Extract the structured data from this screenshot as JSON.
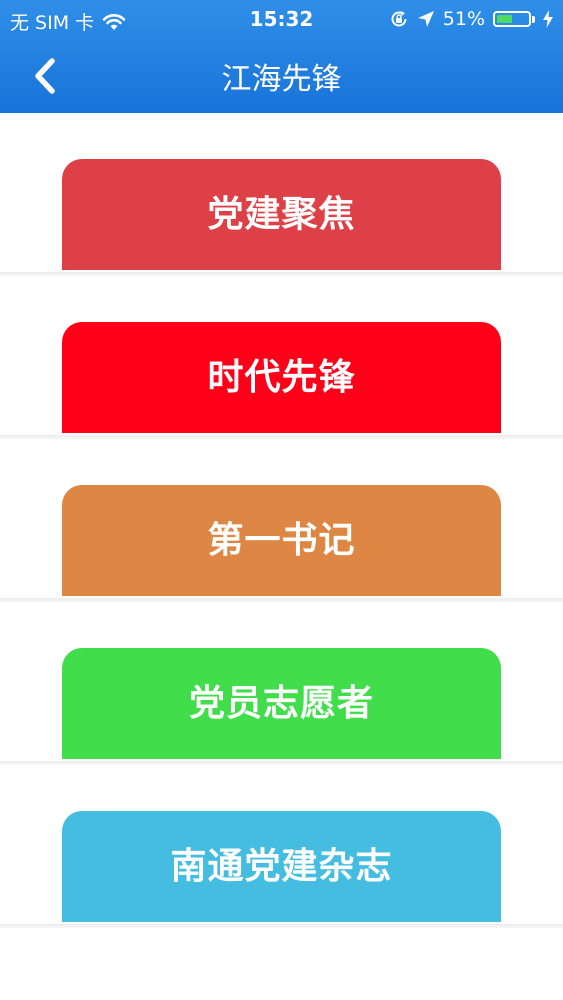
{
  "status_bar": {
    "carrier": "无 SIM 卡",
    "time": "15:32",
    "battery_percent": "51%",
    "battery_level": 0.51,
    "icons": [
      "wifi-icon",
      "rotation-lock-icon",
      "location-arrow-icon",
      "battery-icon",
      "charging-bolt-icon"
    ]
  },
  "nav": {
    "title": "江海先锋",
    "back_icon": "chevron-left-icon"
  },
  "menu": [
    {
      "label": "党建聚焦",
      "color": "#dd4147"
    },
    {
      "label": "时代先锋",
      "color": "#ff0019"
    },
    {
      "label": "第一书记",
      "color": "#de8744"
    },
    {
      "label": "党员志愿者",
      "color": "#42dd4b"
    },
    {
      "label": "南通党建杂志",
      "color": "#44bde1"
    }
  ],
  "colors": {
    "navbar": "#1f7fe0",
    "background": "#ffffff"
  }
}
